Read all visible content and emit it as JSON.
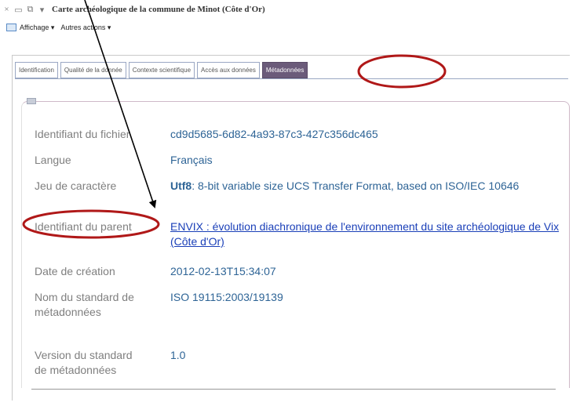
{
  "window": {
    "title": "Carte archéologique de la commune de Minot (Côte d'Or)",
    "controls": [
      "×",
      "▭",
      "⧉",
      "▾"
    ]
  },
  "menu": {
    "icon": "layers-icon",
    "items": [
      "Affichage ▾",
      "Autres actions ▾"
    ]
  },
  "tabs": [
    {
      "label": "Identification",
      "active": false
    },
    {
      "label": "Qualité de la donnée",
      "active": false
    },
    {
      "label": "Contexte scientifique",
      "active": false
    },
    {
      "label": "Accès aux données",
      "active": false
    },
    {
      "label": "Métadonnées",
      "active": true
    }
  ],
  "fields": {
    "file_id": {
      "label": "Identifiant du fichier",
      "value": "cd9d5685-6d82-4a93-87c3-427c356dc465"
    },
    "language": {
      "label": "Langue",
      "value": "Français"
    },
    "charset": {
      "label": "Jeu de caractère",
      "value_bold": "Utf8",
      "value_rest": ": 8-bit variable size UCS Transfer Format, based on ISO/IEC 10646"
    },
    "parent_id": {
      "label": "Identifiant du parent",
      "value": "ENVIX : évolution diachronique de l'environnement du site archéologique de Vix (Côte d'Or)"
    },
    "creation_date": {
      "label": "Date de création",
      "value": "2012-02-13T15:34:07"
    },
    "standard_name": {
      "label": "Nom du standard de métadonnées",
      "value": "ISO 19115:2003/19139"
    },
    "standard_version": {
      "label": "Version du standard de métadonnées",
      "value": "1.0"
    }
  },
  "annotation": {
    "color": "#b01818"
  }
}
